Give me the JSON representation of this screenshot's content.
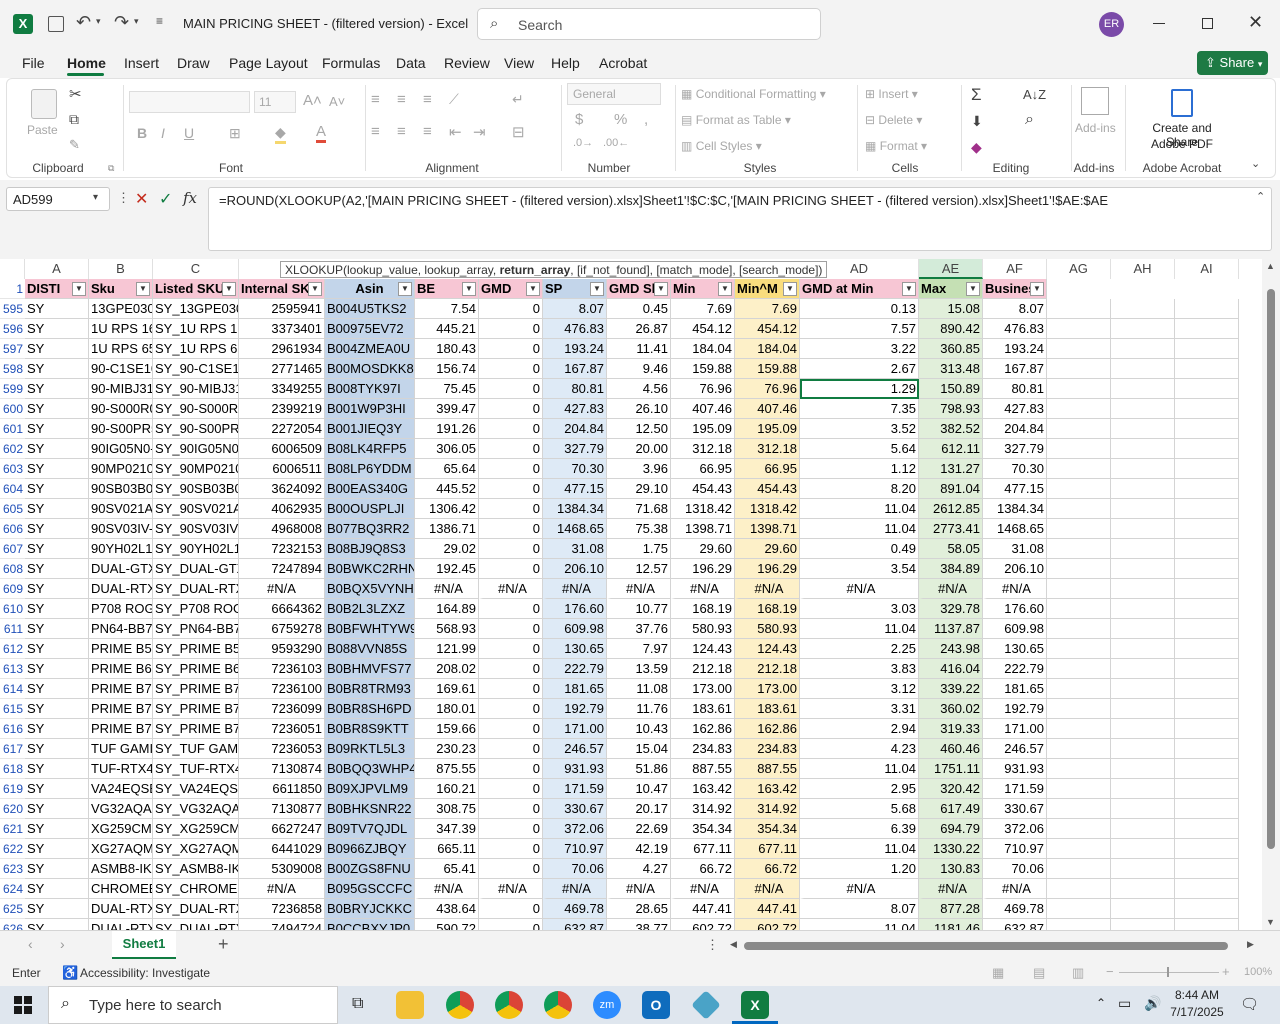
{
  "title": {
    "doc_title": "MAIN PRICING SHEET - (filtered version)  -  Excel",
    "search_placeholder": "Search",
    "user_initials": "ER"
  },
  "menu": {
    "items": [
      "File",
      "Home",
      "Insert",
      "Draw",
      "Page Layout",
      "Formulas",
      "Data",
      "Review",
      "View",
      "Help",
      "Acrobat"
    ],
    "active": "Home",
    "share_label": "Share"
  },
  "ribbon": {
    "clipboard": {
      "paste": "Paste",
      "group": "Clipboard"
    },
    "font": {
      "size": "11",
      "group": "Font"
    },
    "alignment": {
      "group": "Alignment"
    },
    "number": {
      "format": "General",
      "group": "Number"
    },
    "styles": {
      "conditional": "Conditional Formatting",
      "table": "Format as Table",
      "cell": "Cell Styles",
      "group": "Styles"
    },
    "cells": {
      "insert": "Insert",
      "delete": "Delete",
      "format": "Format",
      "group": "Cells"
    },
    "editing": {
      "group": "Editing"
    },
    "addins": {
      "label": "Add-ins",
      "group": "Add-ins"
    },
    "acrobat": {
      "label1": "Create and Share",
      "label2": "Adobe PDF",
      "group": "Adobe Acrobat"
    }
  },
  "formula": {
    "namebox": "AD599",
    "text": "=ROUND(XLOOKUP(A2,'[MAIN PRICING SHEET - (filtered version).xlsx]Sheet1'!$C:$C,'[MAIN PRICING SHEET - (filtered version).xlsx]Sheet1'!$AE:$AE",
    "tooltip_pre": "XLOOKUP(lookup_value, lookup_array, ",
    "tooltip_bold": "return_array",
    "tooltip_post": ", [if_not_found], [match_mode], [search_mode])"
  },
  "columns": [
    "A",
    "B",
    "C",
    "",
    "",
    "",
    "",
    "",
    "",
    "",
    "AD",
    "AE",
    "AF",
    "AG",
    "AH",
    "AI"
  ],
  "headers": [
    "DISTI",
    "Sku",
    "Listed SKU",
    "Internal SK",
    "Asin",
    "BE",
    "GMD",
    "SP",
    "GMD Sl",
    "Min",
    "Min^M",
    "GMD at Min",
    "Max",
    "Busines"
  ],
  "rows": [
    [
      "595",
      "SY",
      "13GPE030",
      "SY_13GPE030",
      "2595941",
      "B004U5TKS2",
      "7.54",
      "0",
      "8.07",
      "0.45",
      "7.69",
      "7.69",
      "0.13",
      "15.08",
      "8.07"
    ],
    [
      "596",
      "SY",
      "1U RPS 16",
      "SY_1U RPS 16",
      "3373401",
      "B00975EV72",
      "445.21",
      "0",
      "476.83",
      "26.87",
      "454.12",
      "454.12",
      "7.57",
      "890.42",
      "476.83"
    ],
    [
      "597",
      "SY",
      "1U RPS 65",
      "SY_1U RPS 65",
      "2961934",
      "B004ZMEA0U",
      "180.43",
      "0",
      "193.24",
      "11.41",
      "184.04",
      "184.04",
      "3.22",
      "360.85",
      "193.24"
    ],
    [
      "598",
      "SY",
      "90-C1SE10",
      "SY_90-C1SE10",
      "2771465",
      "B00MOSDKK8",
      "156.74",
      "0",
      "167.87",
      "9.46",
      "159.88",
      "159.88",
      "2.67",
      "313.48",
      "167.87"
    ],
    [
      "599",
      "SY",
      "90-MIBJ31",
      "SY_90-MIBJ31",
      "3349255",
      "B008TYK97I",
      "75.45",
      "0",
      "80.81",
      "4.56",
      "76.96",
      "76.96",
      "1.29",
      "150.89",
      "80.81"
    ],
    [
      "600",
      "SY",
      "90-S000R0",
      "SY_90-S000R0",
      "2399219",
      "B001W9P3HI",
      "399.47",
      "0",
      "427.83",
      "26.10",
      "407.46",
      "407.46",
      "7.35",
      "798.93",
      "427.83"
    ],
    [
      "601",
      "SY",
      "90-S00PR5",
      "SY_90-S00PR5",
      "2272054",
      "B001JIEQ3Y",
      "191.26",
      "0",
      "204.84",
      "12.50",
      "195.09",
      "195.09",
      "3.52",
      "382.52",
      "204.84"
    ],
    [
      "602",
      "SY",
      "90IG05N0-",
      "SY_90IG05N0-",
      "6006509",
      "B08LK4RFP5",
      "306.05",
      "0",
      "327.79",
      "20.00",
      "312.18",
      "312.18",
      "5.64",
      "612.11",
      "327.79"
    ],
    [
      "603",
      "SY",
      "90MP0210",
      "SY_90MP0210",
      "6006511",
      "B08LP6YDDM",
      "65.64",
      "0",
      "70.30",
      "3.96",
      "66.95",
      "66.95",
      "1.12",
      "131.27",
      "70.30"
    ],
    [
      "604",
      "SY",
      "90SB03B0-",
      "SY_90SB03B0-",
      "3624092",
      "B00EAS340G",
      "445.52",
      "0",
      "477.15",
      "29.10",
      "454.43",
      "454.43",
      "8.20",
      "891.04",
      "477.15"
    ],
    [
      "605",
      "SY",
      "90SV021A",
      "SY_90SV021A",
      "4062935",
      "B00OUSPLJI",
      "1306.42",
      "0",
      "1384.34",
      "71.68",
      "1318.42",
      "1318.42",
      "11.04",
      "2612.85",
      "1384.34"
    ],
    [
      "606",
      "SY",
      "90SV03IV-",
      "SY_90SV03IV-",
      "4968008",
      "B077BQ3RR2",
      "1386.71",
      "0",
      "1468.65",
      "75.38",
      "1398.71",
      "1398.71",
      "11.04",
      "2773.41",
      "1468.65"
    ],
    [
      "607",
      "SY",
      "90YH02L1-",
      "SY_90YH02L1-",
      "7232153",
      "B08BJ9Q8S3",
      "29.02",
      "0",
      "31.08",
      "1.75",
      "29.60",
      "29.60",
      "0.49",
      "58.05",
      "31.08"
    ],
    [
      "608",
      "SY",
      "DUAL-GTX",
      "SY_DUAL-GTX",
      "7247894",
      "B0BWKC2RHN",
      "192.45",
      "0",
      "206.10",
      "12.57",
      "196.29",
      "196.29",
      "3.54",
      "384.89",
      "206.10"
    ],
    [
      "609",
      "SY",
      "DUAL-RTX",
      "SY_DUAL-RTX",
      "#N/A",
      "B0BQX5VYNH",
      "#N/A",
      "#N/A",
      "#N/A",
      "#N/A",
      "#N/A",
      "#N/A",
      "#N/A",
      "#N/A",
      "#N/A"
    ],
    [
      "610",
      "SY",
      "P708 ROG",
      "SY_P708 ROG",
      "6664362",
      "B0B2L3LZXZ",
      "164.89",
      "0",
      "176.60",
      "10.77",
      "168.19",
      "168.19",
      "3.03",
      "329.78",
      "176.60"
    ],
    [
      "611",
      "SY",
      "PN64-BB7",
      "SY_PN64-BB7",
      "6759278",
      "B0BFWHTYW9",
      "568.93",
      "0",
      "609.98",
      "37.76",
      "580.93",
      "580.93",
      "11.04",
      "1137.87",
      "609.98"
    ],
    [
      "612",
      "SY",
      "PRIME B55",
      "SY_PRIME B55",
      "9593290",
      "B088VVN85S",
      "121.99",
      "0",
      "130.65",
      "7.97",
      "124.43",
      "124.43",
      "2.25",
      "243.98",
      "130.65"
    ],
    [
      "613",
      "SY",
      "PRIME B65",
      "SY_PRIME B65",
      "7236103",
      "B0BHMVFS77",
      "208.02",
      "0",
      "222.79",
      "13.59",
      "212.18",
      "212.18",
      "3.83",
      "416.04",
      "222.79"
    ],
    [
      "614",
      "SY",
      "PRIME B76",
      "SY_PRIME B76",
      "7236100",
      "B0BR8TRM93",
      "169.61",
      "0",
      "181.65",
      "11.08",
      "173.00",
      "173.00",
      "3.12",
      "339.22",
      "181.65"
    ],
    [
      "615",
      "SY",
      "PRIME B76",
      "SY_PRIME B76",
      "7236099",
      "B0BR8SH6PD",
      "180.01",
      "0",
      "192.79",
      "11.76",
      "183.61",
      "183.61",
      "3.31",
      "360.02",
      "192.79"
    ],
    [
      "616",
      "SY",
      "PRIME B76",
      "SY_PRIME B76",
      "7236051",
      "B0BR8S9KTT",
      "159.66",
      "0",
      "171.00",
      "10.43",
      "162.86",
      "162.86",
      "2.94",
      "319.33",
      "171.00"
    ],
    [
      "617",
      "SY",
      "TUF GAMI",
      "SY_TUF GAMI",
      "7236053",
      "B09RKTL5L3",
      "230.23",
      "0",
      "246.57",
      "15.04",
      "234.83",
      "234.83",
      "4.23",
      "460.46",
      "246.57"
    ],
    [
      "618",
      "SY",
      "TUF-RTX40",
      "SY_TUF-RTX40",
      "7130874",
      "B0BQQ3WHP4",
      "875.55",
      "0",
      "931.93",
      "51.86",
      "887.55",
      "887.55",
      "11.04",
      "1751.11",
      "931.93"
    ],
    [
      "619",
      "SY",
      "VA24EQSE",
      "SY_VA24EQSE",
      "6611850",
      "B09XJPVLM9",
      "160.21",
      "0",
      "171.59",
      "10.47",
      "163.42",
      "163.42",
      "2.95",
      "320.42",
      "171.59"
    ],
    [
      "620",
      "SY",
      "VG32AQA",
      "SY_VG32AQA",
      "7130877",
      "B0BHKSNR22",
      "308.75",
      "0",
      "330.67",
      "20.17",
      "314.92",
      "314.92",
      "5.68",
      "617.49",
      "330.67"
    ],
    [
      "621",
      "SY",
      "XG259CM",
      "SY_XG259CM",
      "6627247",
      "B09TV7QJDL",
      "347.39",
      "0",
      "372.06",
      "22.69",
      "354.34",
      "354.34",
      "6.39",
      "694.79",
      "372.06"
    ],
    [
      "622",
      "SY",
      "XG27AQM",
      "SY_XG27AQM",
      "6441029",
      "B0966ZJBQY",
      "665.11",
      "0",
      "710.97",
      "42.19",
      "677.11",
      "677.11",
      "11.04",
      "1330.22",
      "710.97"
    ],
    [
      "623",
      "SY",
      "ASMB8-IK",
      "SY_ASMB8-IK",
      "5309008",
      "B00ZGS8FNU",
      "65.41",
      "0",
      "70.06",
      "4.27",
      "66.72",
      "66.72",
      "1.20",
      "130.83",
      "70.06"
    ],
    [
      "624",
      "SY",
      "CHROMEB",
      "SY_CHROMEB",
      "#N/A",
      "B095GSCCFC",
      "#N/A",
      "#N/A",
      "#N/A",
      "#N/A",
      "#N/A",
      "#N/A",
      "#N/A",
      "#N/A",
      "#N/A"
    ],
    [
      "625",
      "SY",
      "DUAL-RTX",
      "SY_DUAL-RTX",
      "7236858",
      "B0BRYJCKKC",
      "438.64",
      "0",
      "469.78",
      "28.65",
      "447.41",
      "447.41",
      "8.07",
      "877.28",
      "469.78"
    ],
    [
      "626",
      "SY",
      "DUAL-RTX",
      "SY_DUAL-RTX",
      "7494724",
      "B0CCBXYJP0",
      "590.72",
      "0",
      "632.87",
      "38.77",
      "602.72",
      "602.72",
      "11.04",
      "1181.46",
      "632.87"
    ]
  ],
  "sheet": {
    "tab": "Sheet1"
  },
  "status": {
    "mode": "Enter",
    "accessibility": "Accessibility: Investigate",
    "zoom": "100%"
  },
  "taskbar": {
    "search_placeholder": "Type here to search",
    "time": "8:44 AM",
    "date": "7/17/2025"
  },
  "colors": {
    "excel_green": "#107c41",
    "share_green": "#1e7a44",
    "hdr_pink": "#f7c6d4",
    "asin_blue": "#c3d5ea",
    "sp_blue": "#deeaf6",
    "min_yellow": "#fdf0c8",
    "max_green": "#e1efda"
  }
}
